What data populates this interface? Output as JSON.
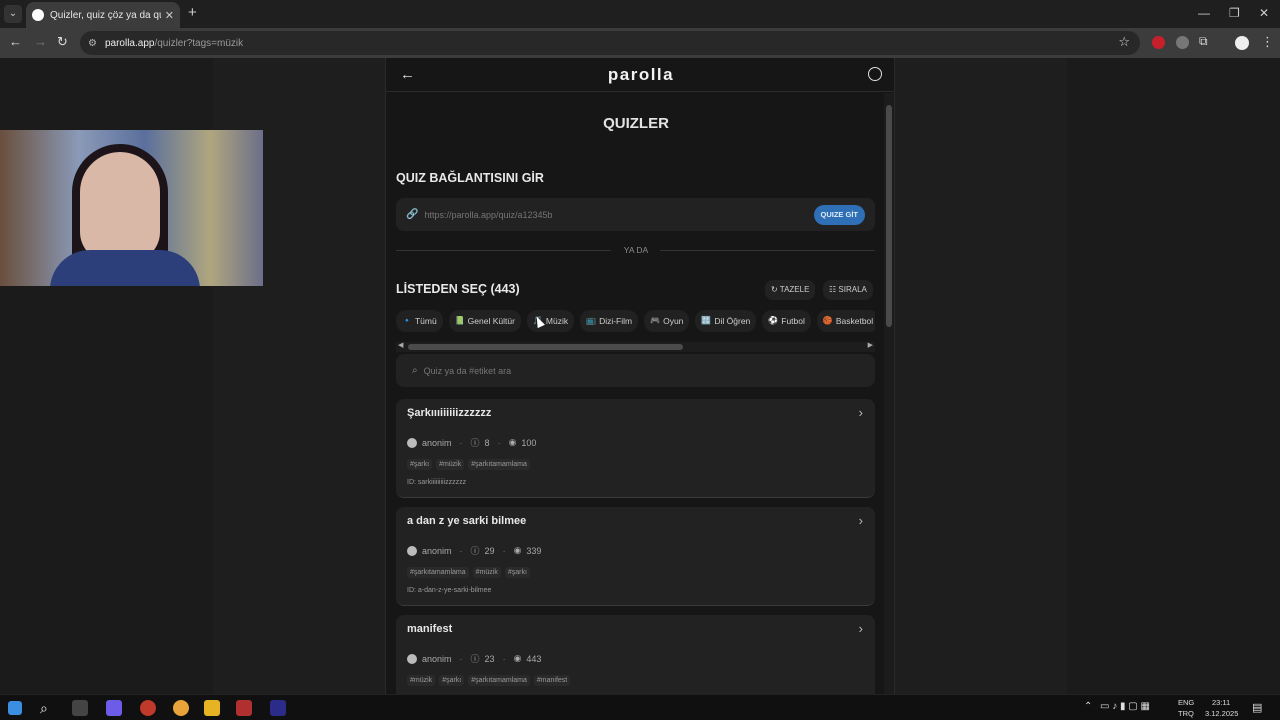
{
  "browser": {
    "tab_title": "Quizler, quiz çöz ya da quiz oluş",
    "tab_close": "✕",
    "new_tab": "+",
    "url_host": "parolla.app",
    "url_path": "/quizler?tags=müzik"
  },
  "app": {
    "logo": "parolla",
    "page_title": "QUIZLER",
    "link_section_title": "QUIZ BAĞLANTISINI GİR",
    "link_placeholder": "https://parolla.app/quiz/a12345b",
    "go_button": "QUIZE GİT",
    "or_text": "YA DA",
    "list_title": "LİSTEDEN SEÇ (443)",
    "refresh_button": "TAZELE",
    "sort_button": "SIRALA",
    "search_placeholder": "Quiz ya da #etiket ara",
    "categories": [
      {
        "label": "Tümü",
        "icon": "🔹"
      },
      {
        "label": "Genel Kültür",
        "icon": "📗"
      },
      {
        "label": "Müzik",
        "icon": "🎵"
      },
      {
        "label": "Dizi-Film",
        "icon": "📺"
      },
      {
        "label": "Oyun",
        "icon": "🎮"
      },
      {
        "label": "Dil Öğren",
        "icon": "🔠"
      },
      {
        "label": "Futbol",
        "icon": "⚽"
      },
      {
        "label": "Basketbol",
        "icon": "🏀"
      }
    ],
    "quizzes": [
      {
        "title": "Şarkıııiiiiiizzzzzz",
        "author": "anonim",
        "questions": "8",
        "views": "100",
        "tags": [
          "#şarkı",
          "#müzik",
          "#şarkıtamamlama"
        ],
        "id": "ID: sarkiiiiiiiiizzzzzz"
      },
      {
        "title": "a dan z ye sarki bilmee",
        "author": "anonim",
        "questions": "29",
        "views": "339",
        "tags": [
          "#şarkıtamamlama",
          "#müzik",
          "#şarkı"
        ],
        "id": "ID: a-dan-z-ye-sarki-bilmee"
      },
      {
        "title": "manifest",
        "author": "anonim",
        "questions": "23",
        "views": "443",
        "tags": [
          "#müzik",
          "#şarkı",
          "#şarkıtamamlama",
          "#manifest"
        ],
        "id": ""
      }
    ]
  },
  "taskbar": {
    "lang_top": "ENG",
    "lang_bottom": "TRQ",
    "time": "23:11",
    "date": "3.12.2025"
  },
  "colors": {
    "accent": "#2f6fb5",
    "background": "#161616",
    "card": "#222222"
  }
}
